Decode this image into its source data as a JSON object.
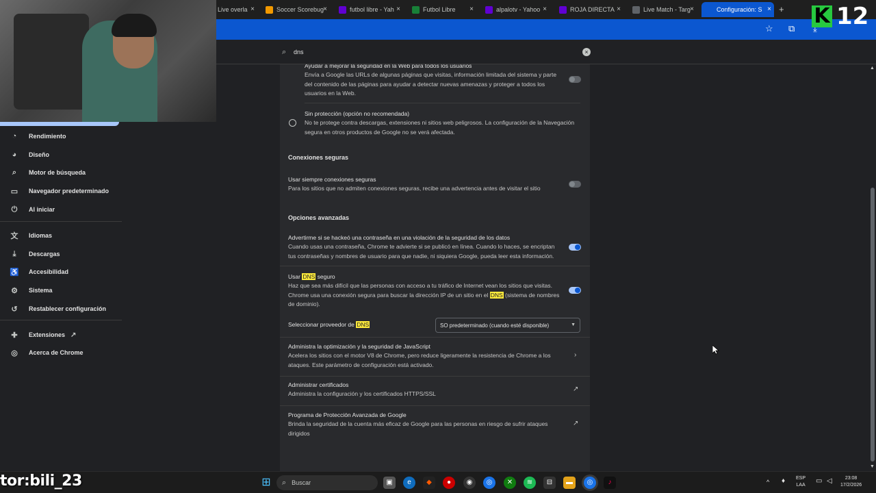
{
  "tabs": [
    {
      "label": "Live overla",
      "favicon": "globe-icon",
      "color": "#3c3c3c"
    },
    {
      "label": "Soccer Scorebug",
      "favicon": "u-icon",
      "color": "#f29900"
    },
    {
      "label": "futbol libre - Yah",
      "favicon": "yahoo-icon",
      "color": "#6001d2"
    },
    {
      "label": "Futbol Libre",
      "favicon": "page-icon",
      "color": "#188038"
    },
    {
      "label": "alpalotv - Yahoo",
      "favicon": "yahoo-icon",
      "color": "#6001d2"
    },
    {
      "label": "ROJA DIRECTA",
      "favicon": "yahoo-icon",
      "color": "#6001d2"
    },
    {
      "label": "Live Match - Targ",
      "favicon": "ball-icon",
      "color": "#5f6368"
    },
    {
      "label": "Configuración: S",
      "favicon": "gear-icon",
      "color": "#0b57d0"
    }
  ],
  "brand": {
    "letter": "K",
    "number": "12"
  },
  "search": {
    "value": "dns"
  },
  "sidebar": {
    "items": [
      {
        "label": "Rendimiento",
        "icon": "speedometer-icon"
      },
      {
        "label": "Diseño",
        "icon": "palette-icon"
      },
      {
        "label": "Motor de búsqueda",
        "icon": "search-icon"
      },
      {
        "label": "Navegador predeterminado",
        "icon": "browser-icon"
      },
      {
        "label": "Al iniciar",
        "icon": "power-icon"
      },
      {
        "label": "Idiomas",
        "icon": "translate-icon"
      },
      {
        "label": "Descargas",
        "icon": "download-icon"
      },
      {
        "label": "Accesibilidad",
        "icon": "accessibility-icon"
      },
      {
        "label": "Sistema",
        "icon": "wrench-icon"
      },
      {
        "label": "Restablecer configuración",
        "icon": "reset-icon"
      },
      {
        "label": "Extensiones",
        "icon": "puzzle-icon"
      },
      {
        "label": "Acerca de Chrome",
        "icon": "chrome-icon"
      }
    ]
  },
  "content": {
    "standard_protection": {
      "title": "Ayudar a mejorar la seguridad en la Web para todos los usuarios",
      "desc": "Envía a Google las URLs de algunas páginas que visitas, información limitada del sistema y parte del contenido de las páginas para ayudar a detectar nuevas amenazas y proteger a todos los usuarios en la Web."
    },
    "no_protection": {
      "title": "Sin protección (opción no recomendada)",
      "desc": "No te protege contra descargas, extensiones ni sitios web peligrosos. La configuración de la Navegación segura en otros productos de Google no se verá afectada."
    },
    "secure_connections_heading": "Conexiones seguras",
    "always_https": {
      "title": "Usar siempre conexiones seguras",
      "desc": "Para los sitios que no admiten conexiones seguras, recibe una advertencia antes de visitar el sitio"
    },
    "advanced_heading": "Opciones avanzadas",
    "password_leak": {
      "title": "Advertirme si se hackeó una contraseña en una violación de la seguridad de los datos",
      "desc": "Cuando usas una contraseña, Chrome te advierte si se publicó en línea. Cuando lo haces, se encriptan tus contraseñas y nombres de usuario para que nadie, ni siquiera Google, pueda leer esta información."
    },
    "secure_dns": {
      "title_pre": "Usar",
      "title_hl": "DNS",
      "title_post": "seguro",
      "desc_1": "Haz que sea más difícil que las personas con acceso a tu tráfico de Internet vean los sitios que visitas. Chrome usa una conexión segura para buscar la dirección IP de un sitio en el",
      "desc_hl": "DNS",
      "desc_2": "(sistema de nombres de dominio)."
    },
    "dns_provider": {
      "label_pre": "Seleccionar proveedor de",
      "label_hl": "DNS",
      "selected": "SO predeterminado (cuando esté disponible)"
    },
    "v8": {
      "title": "Administra la optimización y la seguridad de JavaScript",
      "desc": "Acelera los sitios con el motor V8 de Chrome, pero reduce ligeramente la resistencia de Chrome a los ataques. Este parámetro de configuración está activado."
    },
    "certs": {
      "title": "Administrar certificados",
      "desc": "Administra la configuración y los certificados HTTPS/SSL"
    },
    "advanced_protection": {
      "title": "Programa de Protección Avanzada de Google",
      "desc": "Brinda la seguridad de la cuenta más eficaz de Google para las personas en riesgo de sufrir ataques dirigidos"
    }
  },
  "toggles": {
    "improve_security": false,
    "always_https": false,
    "password_leak": true,
    "secure_dns": true
  },
  "taskbar": {
    "search_placeholder": "Buscar",
    "lang": "ESP",
    "region": "LAA",
    "time": "23:08",
    "date": "17/2/2026"
  },
  "overlay": {
    "name": "tor:bili_23"
  }
}
